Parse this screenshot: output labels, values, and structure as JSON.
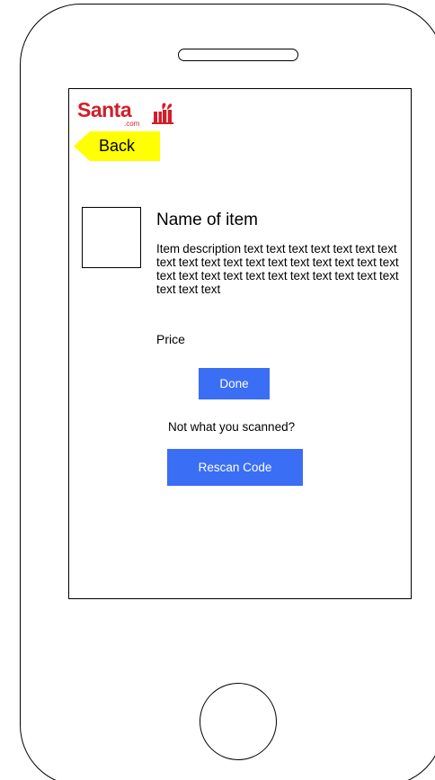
{
  "logo": {
    "brand_text": "Santa",
    "domain_text": ".com",
    "gift_icon": "gift-bag-icon",
    "brand_color": "#d11f2a"
  },
  "nav": {
    "back_label": "Back",
    "back_color": "#ffff00",
    "back_icon": "arrow-left-icon"
  },
  "item": {
    "name": "Name of item",
    "description": "Item description text text text text text text text text text text text text text text text text text text text text text text text text text text text text text text text text",
    "price_label": "Price"
  },
  "actions": {
    "done_label": "Done",
    "rescan_prompt": "Not what you scanned?",
    "rescan_label": "Rescan Code",
    "button_color": "#3a6ef5"
  }
}
